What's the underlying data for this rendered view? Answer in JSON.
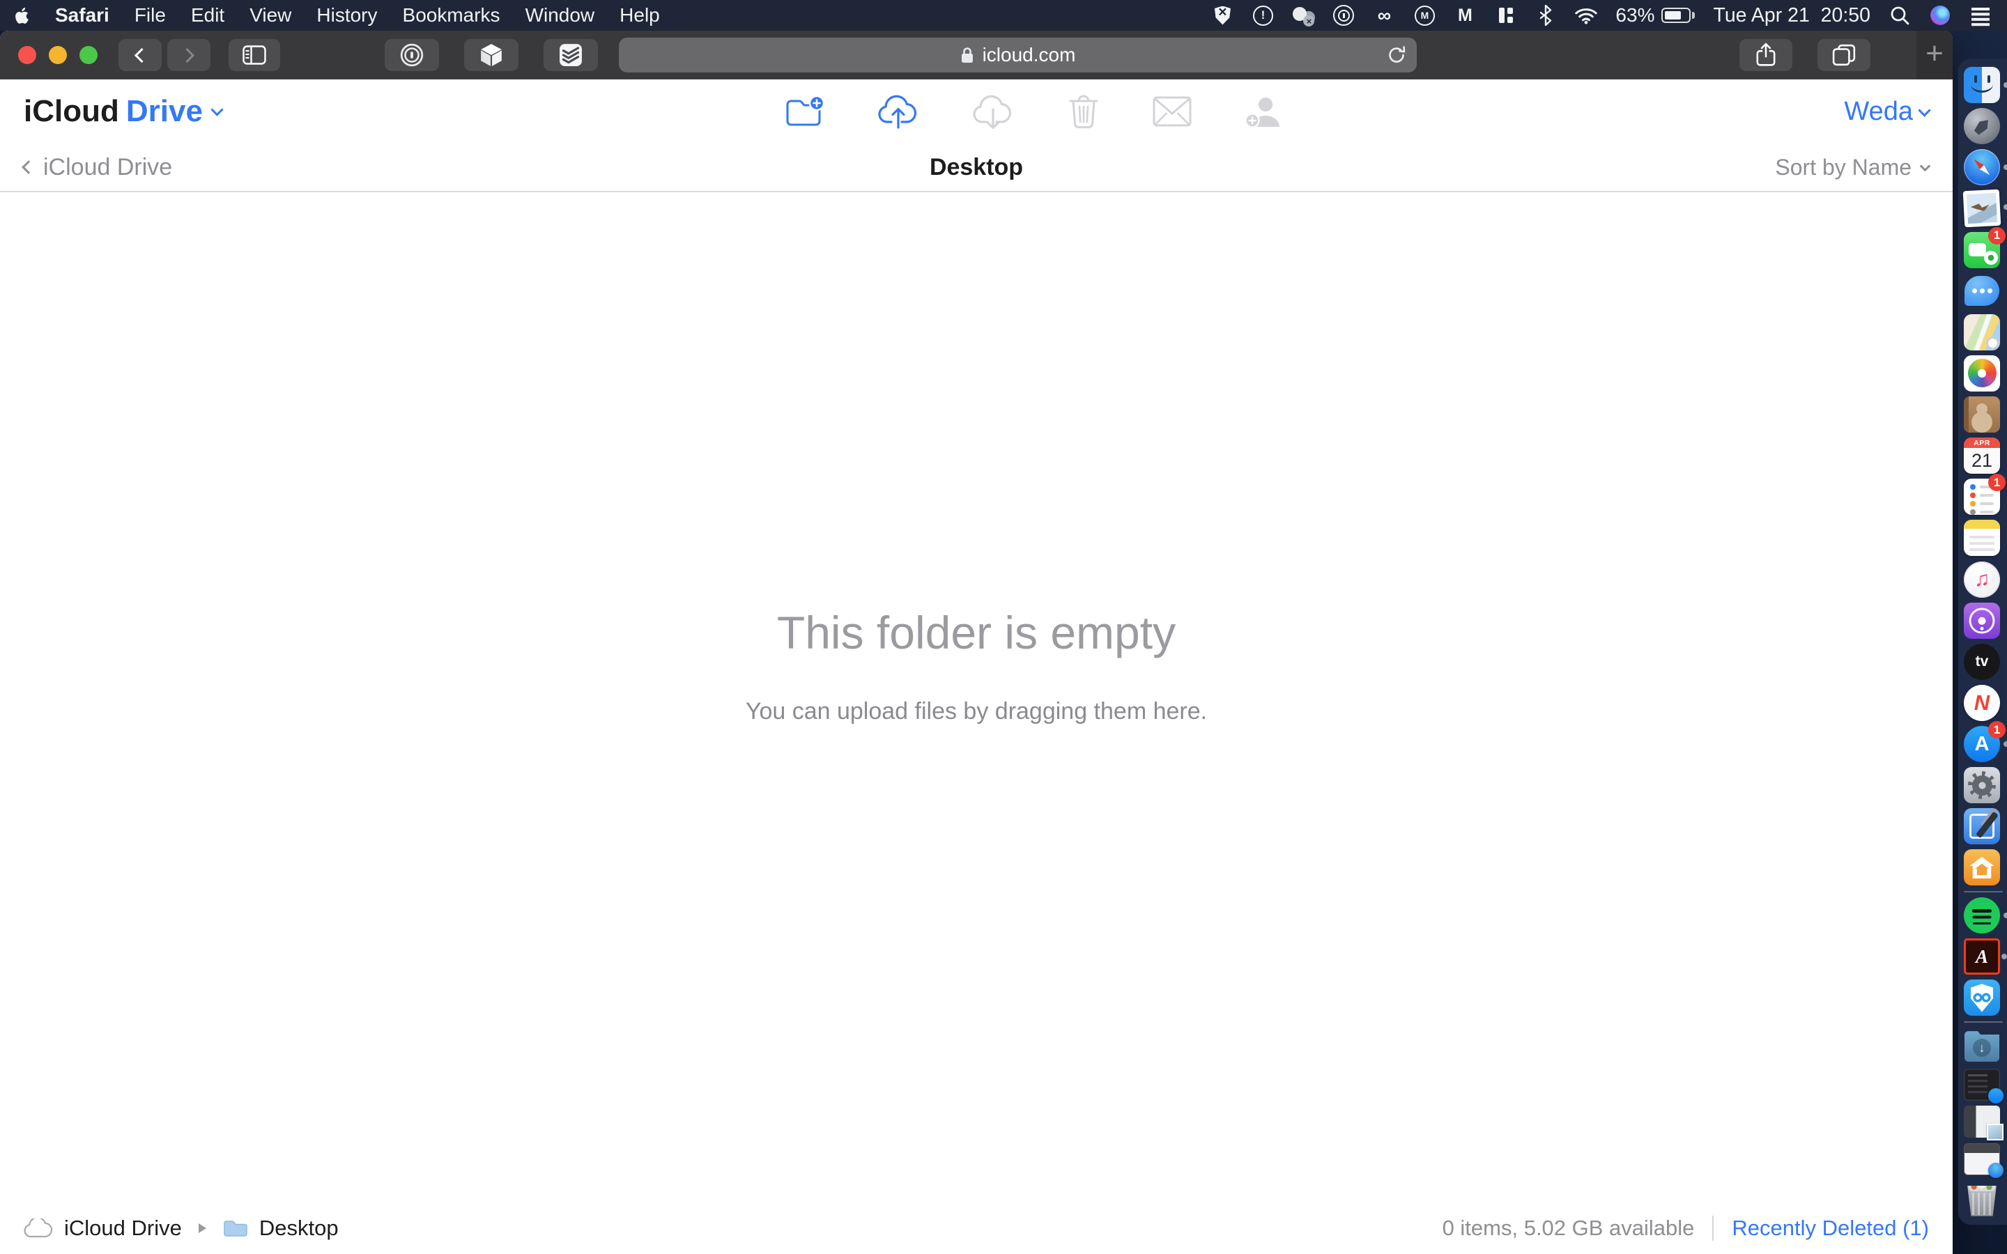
{
  "menu_bar": {
    "menus": [
      "Safari",
      "File",
      "Edit",
      "View",
      "History",
      "Bookmarks",
      "Window",
      "Help"
    ],
    "status": {
      "icons_left": [
        "shield-x",
        "circle-exclamation",
        "overlapping-circles-x",
        "keyhole-circle",
        "creative-cloud",
        "circle-m",
        "letter-m",
        "split-bars",
        "bluetooth",
        "wifi"
      ],
      "battery_percent": "63%",
      "clock": "Tue Apr 21  20:50",
      "icons_right": [
        "spotlight-search",
        "siri",
        "list-menu"
      ]
    }
  },
  "browser": {
    "address": "icloud.com",
    "new_tab_label": "+"
  },
  "icloud": {
    "brand": {
      "black": "iCloud",
      "blue": "Drive"
    },
    "account_name": "Weda",
    "toolbar_icons": [
      "new-folder",
      "upload-to-cloud",
      "download-from-cloud",
      "delete",
      "email-link",
      "add-person"
    ],
    "nav": {
      "back_label": "iCloud Drive",
      "title": "Desktop",
      "sort_label": "Sort by Name"
    },
    "empty_state": {
      "title": "This folder is empty",
      "subtitle": "You can upload files by dragging them here."
    },
    "footer": {
      "crumb_root": "iCloud Drive",
      "crumb_current": "Desktop",
      "status_text": "0 items, 5.02 GB available",
      "recently_deleted": "Recently Deleted (1)"
    }
  },
  "dock": {
    "items": [
      {
        "name": "finder",
        "running": true
      },
      {
        "name": "launchpad"
      },
      {
        "name": "safari",
        "running": true
      },
      {
        "name": "mail",
        "running": true
      },
      {
        "name": "facetime",
        "badge": "1"
      },
      {
        "name": "messages"
      },
      {
        "name": "maps"
      },
      {
        "name": "photos"
      },
      {
        "name": "contacts"
      },
      {
        "name": "calendar",
        "text_top": "APR",
        "text_main": "21"
      },
      {
        "name": "reminders",
        "badge": "1"
      },
      {
        "name": "notes"
      },
      {
        "name": "music"
      },
      {
        "name": "podcasts"
      },
      {
        "name": "tv",
        "text_main": "tv"
      },
      {
        "name": "news",
        "text_main": "N"
      },
      {
        "name": "appstore",
        "text_main": "A",
        "badge": "1",
        "running": true
      },
      {
        "name": "settings"
      },
      {
        "name": "xcode"
      },
      {
        "name": "home"
      },
      {
        "divider": true
      },
      {
        "name": "spotify",
        "running": true
      },
      {
        "name": "acrobat",
        "text_main": "A",
        "running": true
      },
      {
        "name": "vpn"
      },
      {
        "divider": true
      },
      {
        "name": "downloads"
      },
      {
        "name": "min-appstore"
      },
      {
        "name": "min-mail"
      },
      {
        "name": "min-safari"
      },
      {
        "name": "trash"
      }
    ]
  },
  "colors": {
    "accent_blue": "#3478f6",
    "menu_bar_bg": "#1e2637",
    "toolbar_bg": "#39393b",
    "url_field_bg": "#69696c",
    "dock_bg": "rgba(33,44,72,0.95)",
    "badge_red": "#ec3e33",
    "disabled_icon": "#d3d3d8",
    "gray_text": "#8e8e93"
  }
}
